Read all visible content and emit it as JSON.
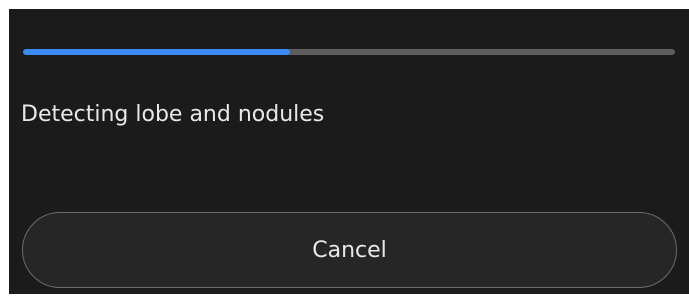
{
  "dialog": {
    "progress": {
      "fraction": 0.41,
      "fill_color": "#3a8af5",
      "track_color": "#5d5d5d"
    },
    "status_text": "Detecting lobe and nodules",
    "cancel_label": "Cancel"
  }
}
